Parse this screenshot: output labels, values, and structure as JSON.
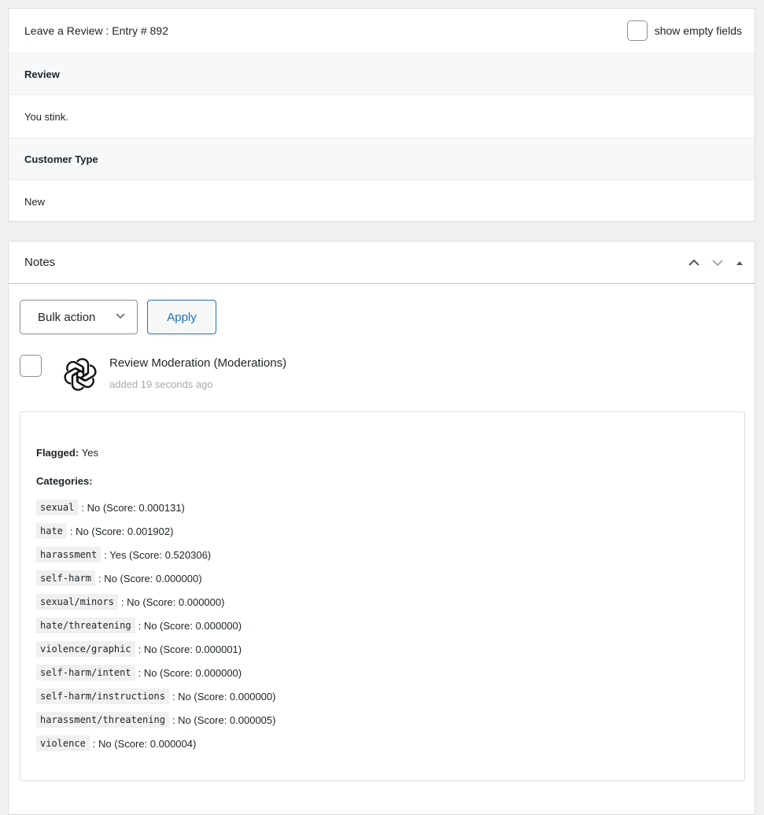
{
  "entry": {
    "title": "Leave a Review : Entry # 892",
    "show_empty_label": "show empty fields",
    "fields": [
      {
        "label": "Review",
        "value": "You stink."
      },
      {
        "label": "Customer Type",
        "value": "New"
      }
    ]
  },
  "notes": {
    "title": "Notes",
    "bulk_action_label": "Bulk action",
    "apply_label": "Apply",
    "note": {
      "title": "Review Moderation (Moderations)",
      "time": "added 19 seconds ago",
      "avatar_icon": "openai-logo-icon",
      "flagged_label": "Flagged:",
      "flagged_value": "Yes",
      "categories_label": "Categories:",
      "categories": [
        {
          "name": "sexual",
          "result": ": No (Score: 0.000131)"
        },
        {
          "name": "hate",
          "result": ": No (Score: 0.001902)"
        },
        {
          "name": "harassment",
          "result": ": Yes (Score: 0.520306)"
        },
        {
          "name": "self-harm",
          "result": ": No (Score: 0.000000)"
        },
        {
          "name": "sexual/minors",
          "result": ": No (Score: 0.000000)"
        },
        {
          "name": "hate/threatening",
          "result": ": No (Score: 0.000000)"
        },
        {
          "name": "violence/graphic",
          "result": ": No (Score: 0.000001)"
        },
        {
          "name": "self-harm/intent",
          "result": ": No (Score: 0.000000)"
        },
        {
          "name": "self-harm/instructions",
          "result": ": No (Score: 0.000000)"
        },
        {
          "name": "harassment/threatening",
          "result": ": No (Score: 0.000005)"
        },
        {
          "name": "violence",
          "result": ": No (Score: 0.000004)"
        }
      ]
    }
  },
  "colors": {
    "accent": "#2271b1",
    "border": "#dcdcde",
    "label_bg": "#f6f8fa"
  }
}
